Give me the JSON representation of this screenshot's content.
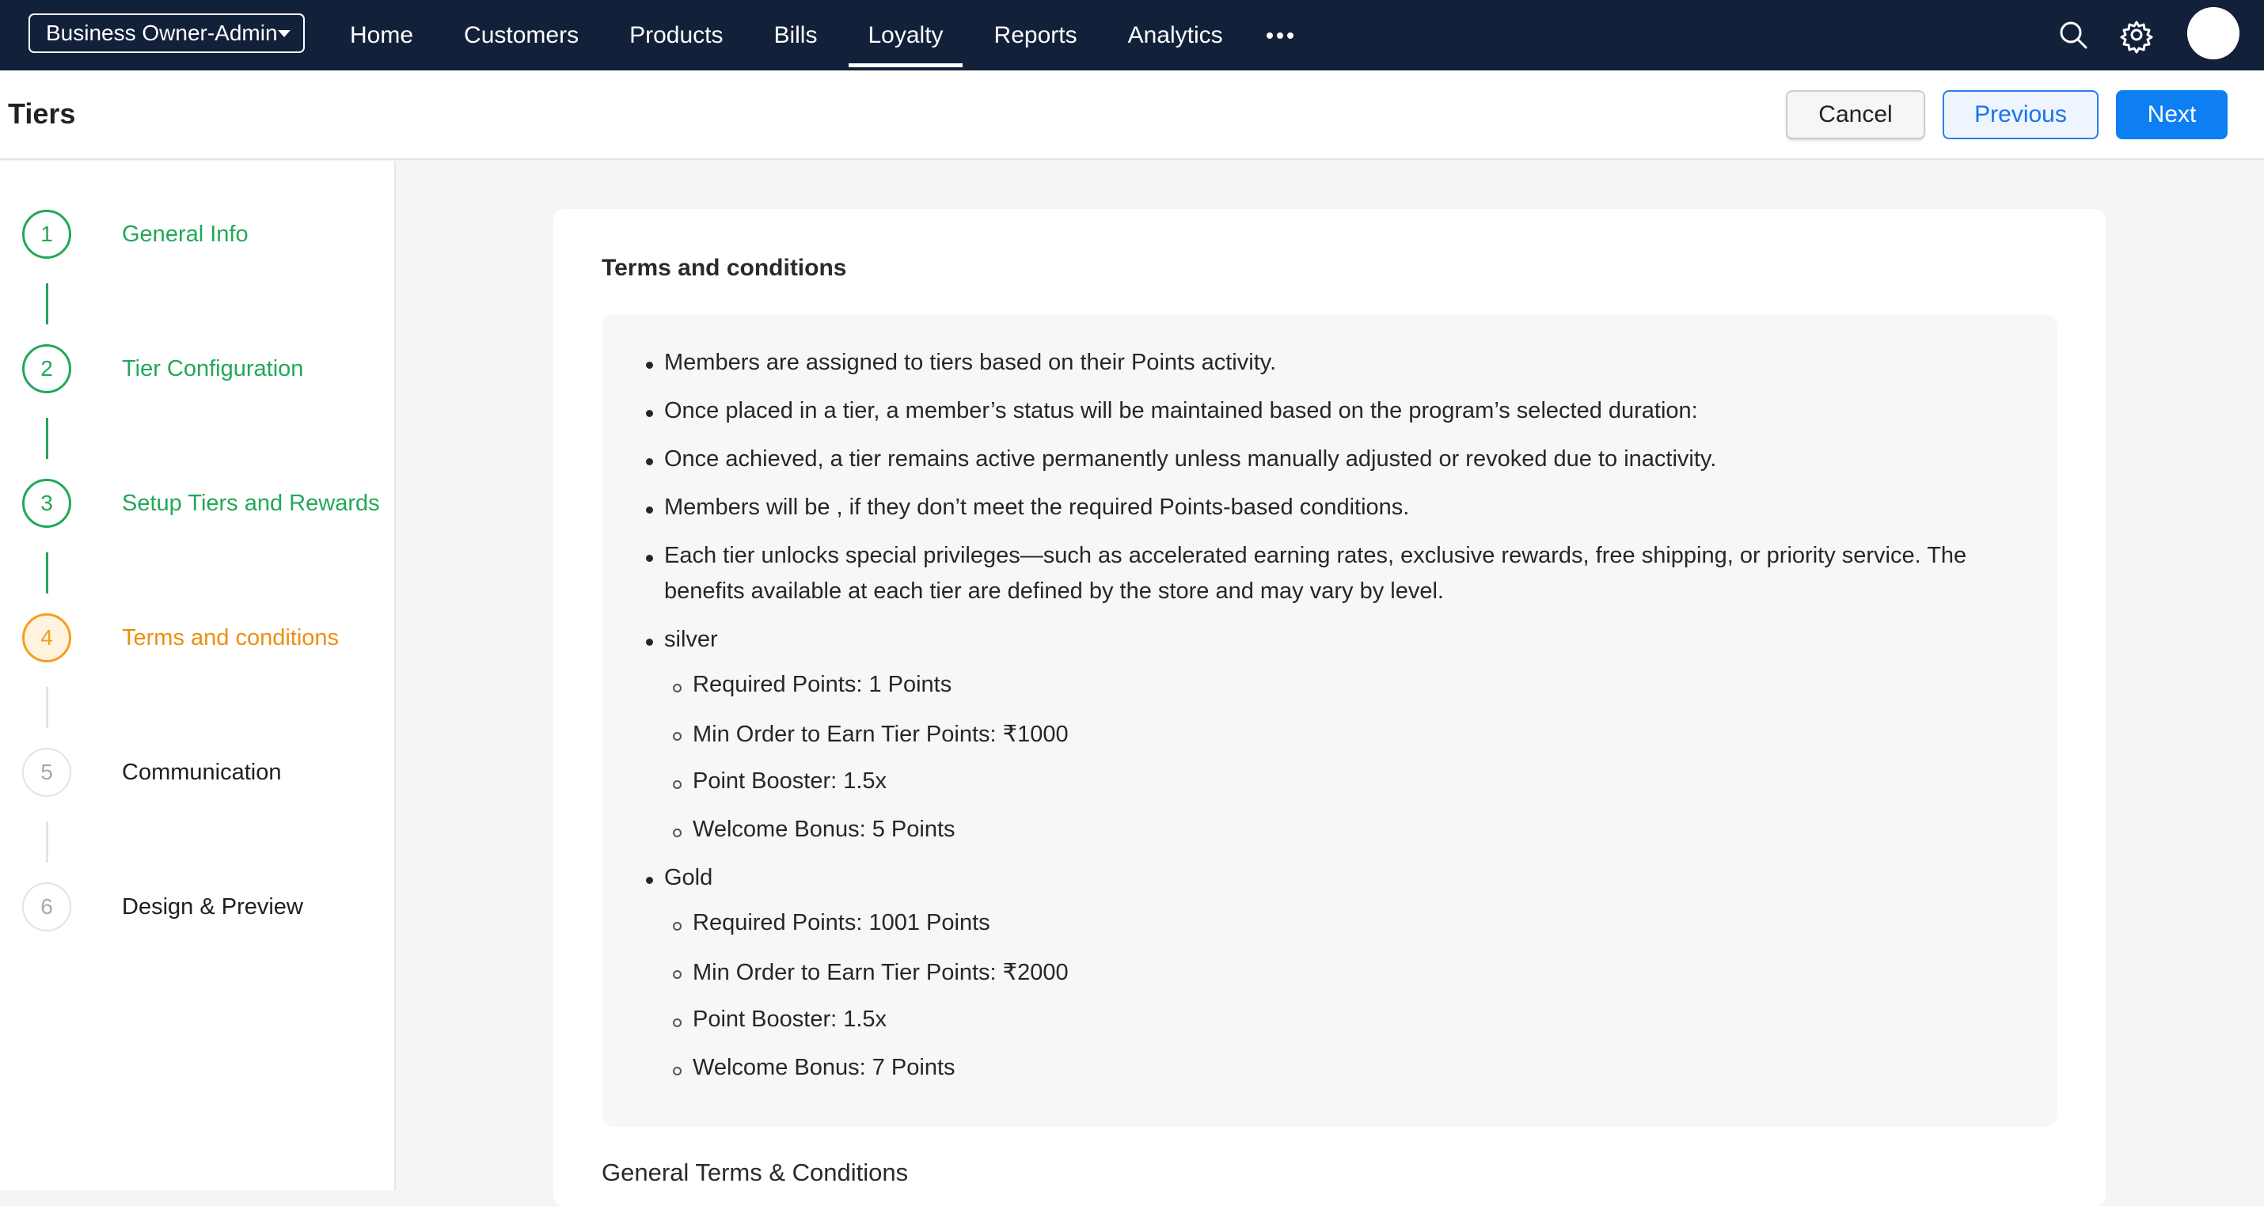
{
  "topbar": {
    "org_selector": "Business Owner-Admin",
    "nav": [
      "Home",
      "Customers",
      "Products",
      "Bills",
      "Loyalty",
      "Reports",
      "Analytics"
    ],
    "active_nav": "Loyalty",
    "icons": [
      "more-icon",
      "search-icon",
      "gear-icon",
      "avatar"
    ]
  },
  "header": {
    "title": "Tiers",
    "cancel_label": "Cancel",
    "previous_label": "Previous",
    "next_label": "Next"
  },
  "steps": [
    {
      "number": "1",
      "label": "General Info",
      "status": "done"
    },
    {
      "number": "2",
      "label": "Tier Configuration",
      "status": "done"
    },
    {
      "number": "3",
      "label": "Setup Tiers and Rewards",
      "status": "done"
    },
    {
      "number": "4",
      "label": "Terms and conditions",
      "status": "current"
    },
    {
      "number": "5",
      "label": "Communication",
      "status": "pending"
    },
    {
      "number": "6",
      "label": "Design & Preview",
      "status": "pending"
    }
  ],
  "terms": {
    "title": "Terms and conditions",
    "items": [
      "Members are assigned to tiers based on their Points activity.",
      "Once placed in a tier, a member’s status will be maintained based on the program’s selected duration:",
      "Once achieved, a tier remains active permanently unless manually adjusted or revoked due to inactivity.",
      "Members will be , if they don’t meet the required Points-based conditions.",
      "Each tier unlocks special privileges—such as accelerated earning rates, exclusive rewards, free shipping, or priority service. The",
      "benefits available at each tier are defined by the store and may vary by level."
    ],
    "tiers": [
      {
        "name": "silver",
        "details": [
          "Required Points: 1 Points",
          "Min Order to Earn Tier Points: ₹1000",
          "Point Booster: 1.5x",
          "Welcome Bonus: 5 Points"
        ]
      },
      {
        "name": "Gold",
        "details": [
          "Required Points: 1001 Points",
          "Min Order to Earn Tier Points: ₹2000",
          "Point Booster: 1.5x",
          "Welcome Bonus: 7 Points"
        ]
      }
    ]
  },
  "general_terms_title": "General Terms & Conditions",
  "colors": {
    "nav_bg": "#13203a",
    "done": "#22a858",
    "current": "#f59e1b",
    "primary": "#0d7ff2"
  }
}
